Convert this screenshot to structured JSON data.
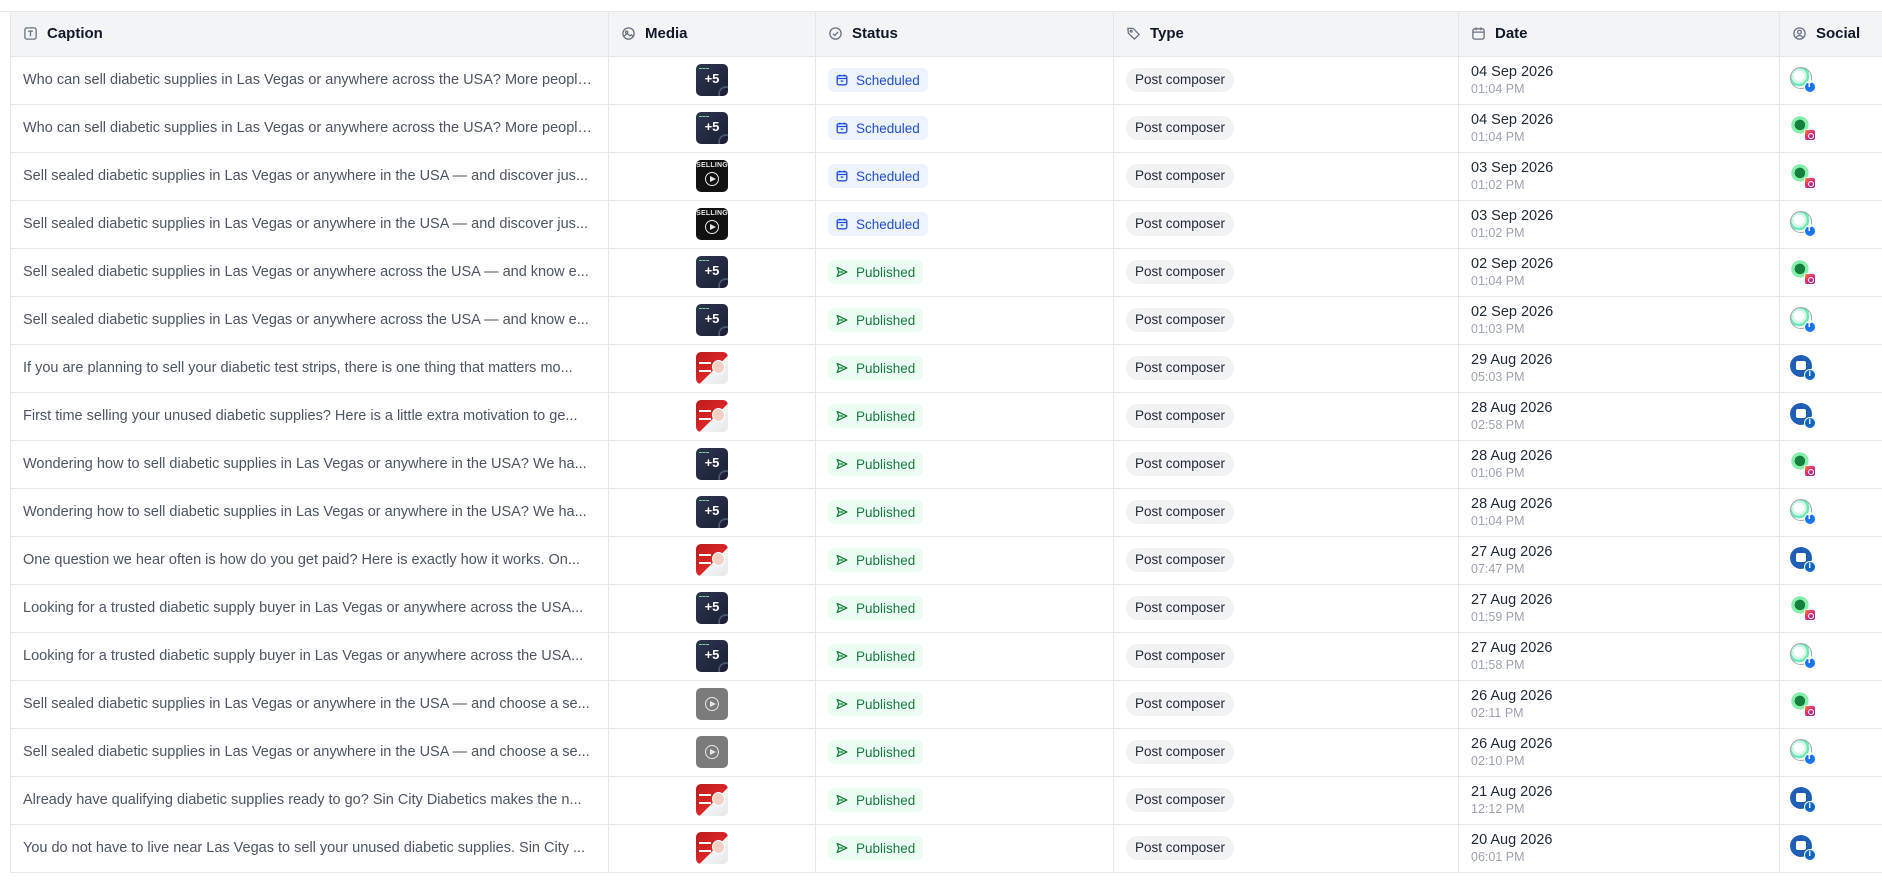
{
  "columns": {
    "caption": "Caption",
    "media": "Media",
    "status": "Status",
    "type": "Type",
    "date": "Date",
    "social": "Social"
  },
  "rows": [
    {
      "caption": "Who can sell diabetic supplies in Las Vegas or anywhere across the USA? More people...",
      "media": "dark-plus",
      "media_text": "+5",
      "status": "Scheduled",
      "type": "Post composer",
      "date": "04 Sep 2026",
      "time": "01:04 PM",
      "avatar": "globe",
      "network": "facebook"
    },
    {
      "caption": "Who can sell diabetic supplies in Las Vegas or anywhere across the USA? More people...",
      "media": "dark-plus",
      "media_text": "+5",
      "status": "Scheduled",
      "type": "Post composer",
      "date": "04 Sep 2026",
      "time": "01:04 PM",
      "avatar": "leaf",
      "network": "instagram"
    },
    {
      "caption": "Sell sealed diabetic supplies in Las Vegas or anywhere in the USA — and discover jus...",
      "media": "black-video",
      "media_text": "SELLING",
      "status": "Scheduled",
      "type": "Post composer",
      "date": "03 Sep 2026",
      "time": "01:02 PM",
      "avatar": "leaf",
      "network": "instagram"
    },
    {
      "caption": "Sell sealed diabetic supplies in Las Vegas or anywhere in the USA — and discover jus...",
      "media": "black-video",
      "media_text": "SELLING",
      "status": "Scheduled",
      "type": "Post composer",
      "date": "03 Sep 2026",
      "time": "01:02 PM",
      "avatar": "globe",
      "network": "facebook"
    },
    {
      "caption": "Sell sealed diabetic supplies in Las Vegas or anywhere across the USA — and know e...",
      "media": "dark-plus",
      "media_text": "+5",
      "status": "Published",
      "type": "Post composer",
      "date": "02 Sep 2026",
      "time": "01:04 PM",
      "avatar": "leaf",
      "network": "instagram"
    },
    {
      "caption": "Sell sealed diabetic supplies in Las Vegas or anywhere across the USA — and know e...",
      "media": "dark-plus",
      "media_text": "+5",
      "status": "Published",
      "type": "Post composer",
      "date": "02 Sep 2026",
      "time": "01:03 PM",
      "avatar": "globe",
      "network": "facebook"
    },
    {
      "caption": "If you are planning to sell your diabetic test strips, there is one thing that matters mo...",
      "media": "red-photo",
      "media_text": "",
      "status": "Published",
      "type": "Post composer",
      "date": "29 Aug 2026",
      "time": "05:03 PM",
      "avatar": "blue",
      "network": "linkedin"
    },
    {
      "caption": "First time selling your unused diabetic supplies? Here is a little extra motivation to ge...",
      "media": "red-photo",
      "media_text": "",
      "status": "Published",
      "type": "Post composer",
      "date": "28 Aug 2026",
      "time": "02:58 PM",
      "avatar": "blue",
      "network": "linkedin"
    },
    {
      "caption": "Wondering how to sell diabetic supplies in Las Vegas or anywhere in the USA? We ha...",
      "media": "dark-plus",
      "media_text": "+5",
      "status": "Published",
      "type": "Post composer",
      "date": "28 Aug 2026",
      "time": "01:06 PM",
      "avatar": "leaf",
      "network": "instagram"
    },
    {
      "caption": "Wondering how to sell diabetic supplies in Las Vegas or anywhere in the USA? We ha...",
      "media": "dark-plus",
      "media_text": "+5",
      "status": "Published",
      "type": "Post composer",
      "date": "28 Aug 2026",
      "time": "01:04 PM",
      "avatar": "globe",
      "network": "facebook"
    },
    {
      "caption": "One question we hear often is how do you get paid? Here is exactly how it works. On...",
      "media": "red-photo",
      "media_text": "",
      "status": "Published",
      "type": "Post composer",
      "date": "27 Aug 2026",
      "time": "07:47 PM",
      "avatar": "blue",
      "network": "linkedin"
    },
    {
      "caption": "Looking for a trusted diabetic supply buyer in Las Vegas or anywhere across the USA...",
      "media": "dark-plus",
      "media_text": "+5",
      "status": "Published",
      "type": "Post composer",
      "date": "27 Aug 2026",
      "time": "01:59 PM",
      "avatar": "leaf",
      "network": "instagram"
    },
    {
      "caption": "Looking for a trusted diabetic supply buyer in Las Vegas or anywhere across the USA...",
      "media": "dark-plus",
      "media_text": "+5",
      "status": "Published",
      "type": "Post composer",
      "date": "27 Aug 2026",
      "time": "01:58 PM",
      "avatar": "globe",
      "network": "facebook"
    },
    {
      "caption": "Sell sealed diabetic supplies in Las Vegas or anywhere in the USA — and choose a se...",
      "media": "grey-video",
      "media_text": "",
      "status": "Published",
      "type": "Post composer",
      "date": "26 Aug 2026",
      "time": "02:11 PM",
      "avatar": "leaf",
      "network": "instagram"
    },
    {
      "caption": "Sell sealed diabetic supplies in Las Vegas or anywhere in the USA — and choose a se...",
      "media": "grey-video",
      "media_text": "",
      "status": "Published",
      "type": "Post composer",
      "date": "26 Aug 2026",
      "time": "02:10 PM",
      "avatar": "globe",
      "network": "facebook"
    },
    {
      "caption": "Already have qualifying diabetic supplies ready to go? Sin City Diabetics makes the n...",
      "media": "red-photo",
      "media_text": "",
      "status": "Published",
      "type": "Post composer",
      "date": "21 Aug 2026",
      "time": "12:12 PM",
      "avatar": "blue",
      "network": "linkedin"
    },
    {
      "caption": "You do not have to live near Las Vegas to sell your unused diabetic supplies. Sin City ...",
      "media": "red-photo",
      "media_text": "",
      "status": "Published",
      "type": "Post composer",
      "date": "20 Aug 2026",
      "time": "06:01 PM",
      "avatar": "blue",
      "network": "linkedin"
    }
  ],
  "colors": {
    "scheduled_bg": "#eef4ff",
    "scheduled_fg": "#1d4ed8",
    "published_bg": "#ecfdf3",
    "published_fg": "#15803d",
    "header_bg": "#f3f4f6",
    "border": "#e5e7eb"
  },
  "icons": {
    "caption": "text-box-icon",
    "media": "image-icon",
    "status": "check-circle-icon",
    "type": "tag-icon",
    "date": "calendar-icon",
    "social": "user-circle-icon",
    "scheduled": "calendar-clock-icon",
    "published": "send-icon"
  }
}
